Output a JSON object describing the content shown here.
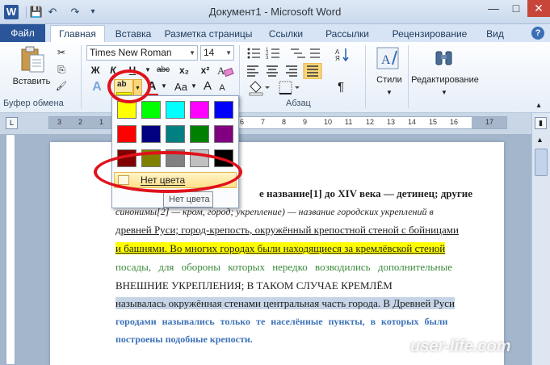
{
  "titlebar": {
    "title": "Документ1 - Microsoft Word",
    "logo": "W",
    "qat": {
      "save_icon": "💾",
      "undo_icon": "↶",
      "redo_icon": "↷",
      "customize_icon": "▾"
    },
    "minimize": "—",
    "maximize": "□",
    "close": "✕"
  },
  "tabs": {
    "file": "Файл",
    "items": [
      "Главная",
      "Вставка",
      "Разметка страницы",
      "Ссылки",
      "Рассылки",
      "Рецензирование",
      "Вид"
    ],
    "active": "Главная",
    "help": "?"
  },
  "ribbon": {
    "clipboard": {
      "paste_label": "Вставить",
      "group_label": "Буфер обмена",
      "cut_icon": "✂",
      "copy_icon": "⎘",
      "format_painter_icon": "🖌"
    },
    "font": {
      "font_name": "Times New Roman",
      "font_size": "14",
      "grow": "A",
      "shrink": "A",
      "bold": "Ж",
      "italic": "К",
      "underline": "Ч",
      "strikethrough": "abc",
      "subscript": "x₂",
      "superscript": "x²",
      "change_case": "Aa",
      "text_effects": "A",
      "highlight_glyph": "ab",
      "font_color_glyph": "A"
    },
    "paragraph": {
      "group_label": "Абзац",
      "pilcrow": "¶"
    },
    "styles": {
      "label": "Стили"
    },
    "editing": {
      "label": "Редактирование"
    }
  },
  "ruler": {
    "numbers": [
      "3",
      "2",
      "1",
      "1",
      "2",
      "3",
      "4",
      "5",
      "6",
      "7",
      "8",
      "9",
      "10",
      "11",
      "12",
      "13",
      "14",
      "15",
      "16",
      "17"
    ]
  },
  "highlight_menu": {
    "colors": [
      "#ffff00",
      "#00ff00",
      "#00ffff",
      "#ff00ff",
      "#0000ff",
      "#ff0000",
      "#000080",
      "#008080",
      "#008000",
      "#800080",
      "#800000",
      "#808000",
      "#808080",
      "#c0c0c0",
      "#000000"
    ],
    "no_color_label": "Нет цвета",
    "tooltip": "Нет цвета"
  },
  "document": {
    "lines": [
      "е название[1] до XIV века — детинец; другие",
      "синонимы[2] — кром, город; укрепление) — название городских укреплений в",
      "древней Руси; город-крепость, окружённый крепостной стеной с бойницами",
      "и башнями. Во многих городах были находящиеся за кремлёвской стеной",
      "посады, для обороны которых нередко возводились дополнительные",
      "ВНЕШНИЕ УКРЕПЛЕНИЯ; В ТАКОМ СЛУЧАЕ КРЕМЛЁМ",
      "называлась окружённая стенами центральная часть города. В Древней Руси",
      "городами назывались только те населённые пункты, в которых были",
      "построены подобные крепости."
    ]
  },
  "watermark": "user-life.com"
}
